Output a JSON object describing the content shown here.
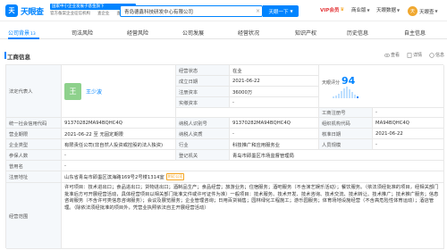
{
  "header": {
    "logo_mark": "天",
    "logo_text": "天眼查",
    "slogan_1": "国家中小企业发展子基金旗下",
    "slogan_2": [
      "官方备案企业征信机构",
      "查企业",
      "查老板"
    ],
    "search_value": "青岛德鑫科技研发中心有限公司",
    "search_clear": "×",
    "search_button": "天眼一下",
    "vip": "VIP会员",
    "business": "商业版",
    "eye": "天眼数据",
    "user_avatar": "天",
    "user_name": "天眼查"
  },
  "tabs": [
    {
      "label": "公司背景",
      "count": "13",
      "active": true
    },
    {
      "label": "司法风险",
      "count": "",
      "active": false
    },
    {
      "label": "经营风险",
      "count": "",
      "active": false
    },
    {
      "label": "公司发展",
      "count": "",
      "active": false
    },
    {
      "label": "经营状况",
      "count": "",
      "active": false
    },
    {
      "label": "知识产权",
      "count": "",
      "active": false
    },
    {
      "label": "历史信息",
      "count": "",
      "active": false
    },
    {
      "label": "自主信息",
      "count": "",
      "active": false
    }
  ],
  "section": {
    "title": "工商信息",
    "actions": [
      "查看",
      "详情",
      "信息"
    ]
  },
  "info": {
    "legal_rep_label": "法定代表人",
    "legal_rep_avatar": "王",
    "legal_rep_name": "王少波",
    "status_label": "经营状态",
    "status_value": "在业",
    "estab_label": "成立日期",
    "estab_value": "2021-06-22",
    "capital_label": "注册资本",
    "capital_value": "36000万",
    "paid_label": "实缴资本",
    "paid_value": "-",
    "score_label": "天眼评分",
    "score_value": "94",
    "credit_code_label": "统一社会信用代码",
    "credit_code_value": "91370282MA94BQHC4Q",
    "taxpayer_label": "纳税人识别号",
    "taxpayer_value": "91370282MA94BQHC4Q",
    "reg_no_label": "工商注册号",
    "reg_no_value": "-",
    "org_code_label": "组织机构代码",
    "org_code_value": "MA94BQHC4Q",
    "term_label": "营业期限",
    "term_value": "2021-06-22 至 无固定期限",
    "taxpayer_qual_label": "纳税人资质",
    "taxpayer_qual_value": "-",
    "approval_label": "核准日期",
    "approval_value": "2021-06-22",
    "type_label": "企业类型",
    "type_value": "有限责任公司(非自然人投资或控股的法人独资)",
    "industry_label": "行业",
    "industry_value": "科技推广和应用服务业",
    "staff_label": "人员规模",
    "staff_value": "-",
    "insured_label": "参保人数",
    "insured_value": "-",
    "authority_label": "登记机关",
    "authority_value": "青岛市即墨区市场监督管理局",
    "former_label": "曾用名",
    "former_value": "-",
    "address_label": "注册地址",
    "address_value": "山东省青岛市即墨区滨海路169号2号楼1314室",
    "address_tag": "附近公司",
    "scope_label": "经营范围",
    "scope_value": "许可项目：技术进出口；食品进出口；货物进出口；酒制品生产；食品经营；旅游业务；住宿服务；酒吧服务（不含演艺娱乐活动）；餐饮服务。（依法须经批准的项目，经相关部门批准后方可开展经营活动，具体经营项目以相关部门批准文件或许可证件为准）一般项目：技术服务、技术开发、技术咨询、技术交流、技术转让、技术推广；技术推广服务；信息咨询服务（不含许可类信息咨询服务）；会议及展览服务；企业管理咨询；日用百货销售；园林绿化工程施工；游乐园服务；体育场地设施经营（不含高危险性体育运动）；酒店管理。（除依法须经批准的项目外，凭营业执照依法自主开展经营活动）"
  },
  "colors": {
    "accent": "#0084ff",
    "label_bg": "#f5f8fb",
    "avatar_green": "#8ed18c",
    "vip_red": "#e4393c"
  }
}
